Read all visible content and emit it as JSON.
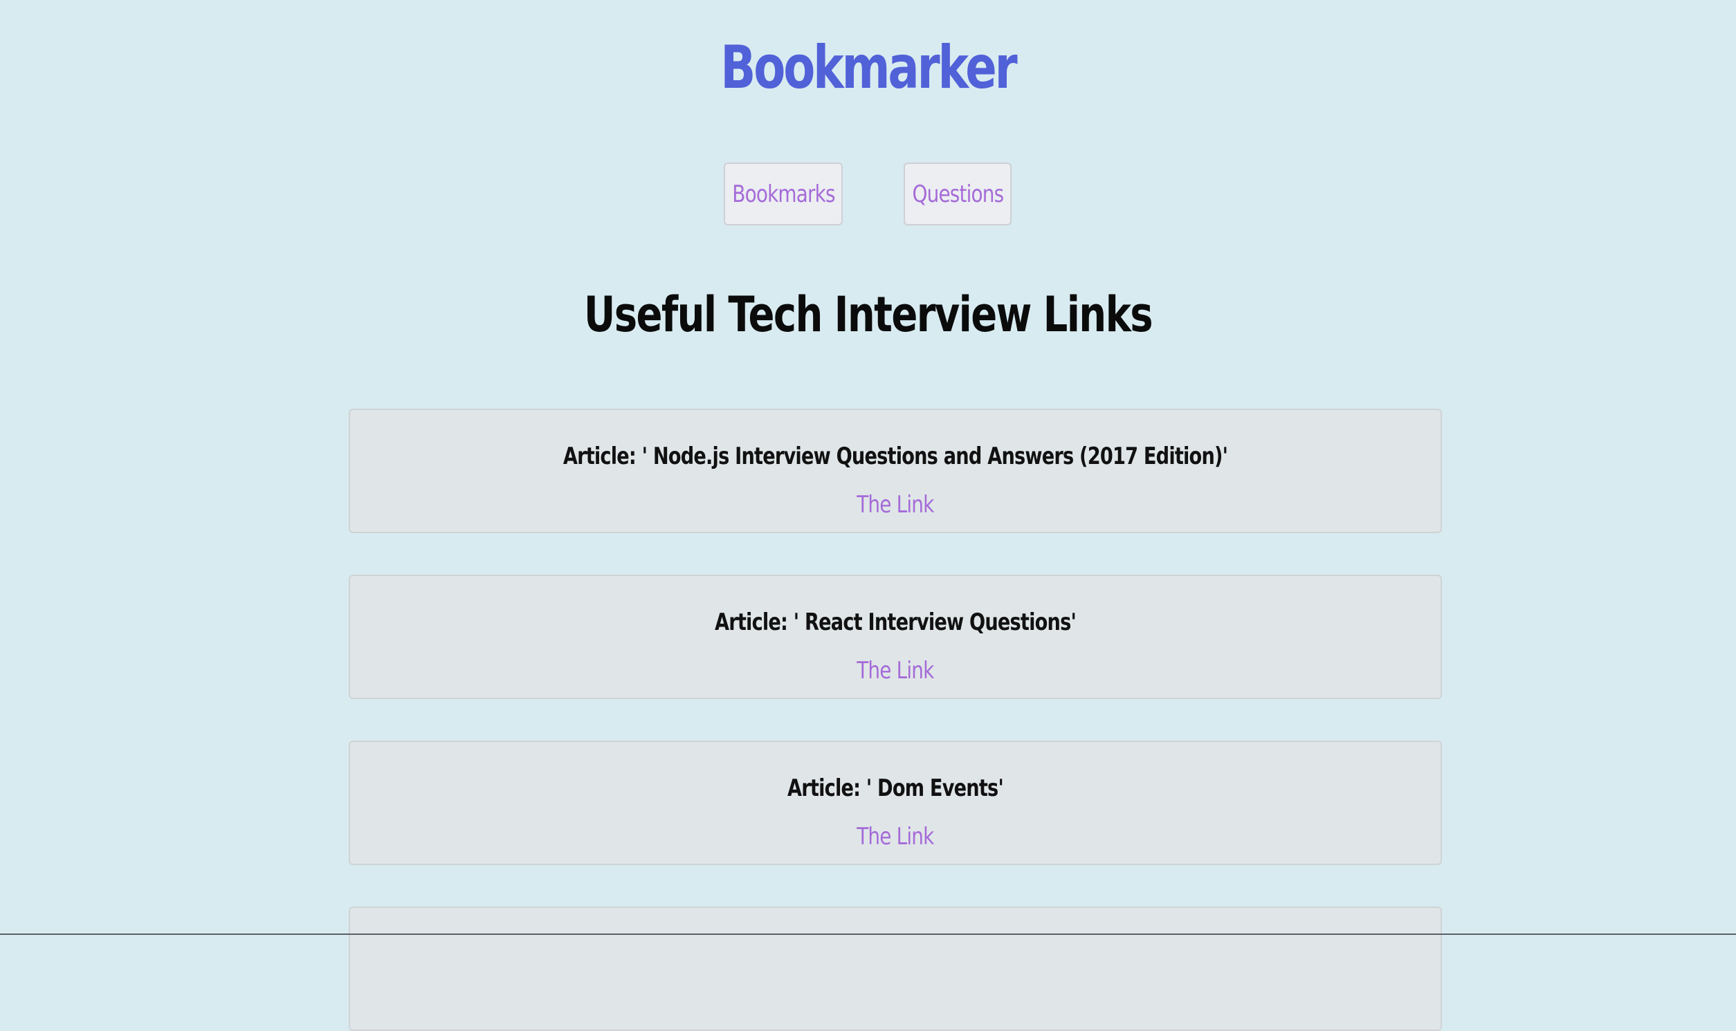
{
  "app": {
    "title": "Bookmarker"
  },
  "nav": {
    "buttons": [
      {
        "label": "Bookmarks"
      },
      {
        "label": "Questions"
      }
    ]
  },
  "main": {
    "heading": "Useful Tech Interview Links",
    "cards": [
      {
        "title": "Article: ' Node.js Interview Questions and Answers (2017 Edition)'",
        "link_label": "The Link"
      },
      {
        "title": "Article: ' React Interview Questions'",
        "link_label": "The Link"
      },
      {
        "title": "Article: ' Dom Events'",
        "link_label": "The Link"
      },
      {
        "title": "",
        "link_label": ""
      }
    ]
  },
  "colors": {
    "background": "#d8ebf1",
    "brand": "#5161d8",
    "link": "#a56bd8",
    "card_background": "#e0e6e8"
  }
}
